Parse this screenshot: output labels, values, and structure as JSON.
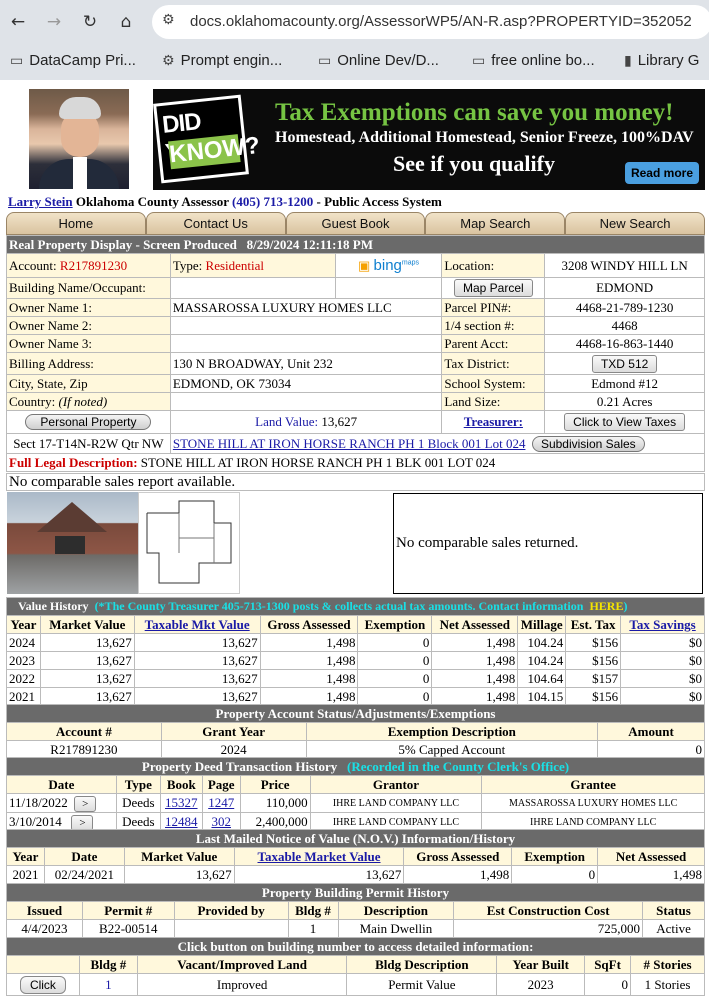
{
  "browser": {
    "url": "docs.oklahomacounty.org/AssessorWP5/AN-R.asp?PROPERTYID=352052",
    "bookmarks": [
      "DataCamp Pri...",
      "Prompt engin...",
      "Online Dev/D...",
      "free online bo...",
      "Library G"
    ]
  },
  "banner": {
    "badge_top": "DID YOU",
    "badge_bottom": "KNOW?",
    "headline": "Tax Exemptions can save you money!",
    "subline": "Homestead, Additional Homestead, Senior Freeze, 100%DAV",
    "cta": "See if you qualify",
    "read_more": "Read more"
  },
  "header": {
    "assessor_name": "Larry Stein",
    "office": "Oklahoma County Assessor",
    "phone": "(405) 713-1200",
    "tagline": "- Public Access System"
  },
  "menu": [
    "Home",
    "Contact Us",
    "Guest Book",
    "Map Search",
    "New Search"
  ],
  "display": {
    "title": "Real Property Display - Screen Produced",
    "produced": "8/29/2024 12:11:18 PM"
  },
  "property": {
    "account_label": "Account:",
    "account": "R217891230",
    "type_label": "Type:",
    "type": "Residential",
    "bing": "bing",
    "bing_sub": "maps",
    "location_label": "Location:",
    "location": "3208 WINDY HILL LN",
    "building_label": "Building Name/Occupant:",
    "map_parcel": "Map Parcel",
    "city": "EDMOND",
    "owner1_label": "Owner Name 1:",
    "owner1": "MASSAROSSA LUXURY HOMES LLC",
    "pin_label": "Parcel PIN#:",
    "pin": "4468-21-789-1230",
    "owner2_label": "Owner Name 2:",
    "quarter_label": "1/4 section #:",
    "quarter": "4468",
    "owner3_label": "Owner Name 3:",
    "parent_label": "Parent Acct:",
    "parent": "4468-16-863-1440",
    "billing_label": "Billing Address:",
    "billing": "130 N BROADWAY, Unit 232",
    "taxdist_label": "Tax District:",
    "taxdist": "TXD 512",
    "csz_label": "City, State, Zip",
    "csz": "EDMOND, OK  73034",
    "school_label": "School System:",
    "school": "Edmond #12",
    "country_label": "Country:",
    "country_note": "(If noted)",
    "landsize_label": "Land Size:",
    "landsize": "0.21  Acres",
    "personal_property": "Personal Property",
    "land_value_label": "Land Value:",
    "land_value": "13,627",
    "treasurer": "Treasurer:",
    "view_taxes": "Click to View Taxes",
    "sect": "Sect 17-T14N-R2W Qtr NW",
    "subdivision": "STONE HILL AT IRON HORSE RANCH PH 1   Block 001  Lot 024",
    "subdivision_sales": "Subdivision Sales",
    "legal_label": "Full Legal Description:",
    "legal": "STONE HILL AT IRON HORSE RANCH PH 1 BLK 001 LOT 024"
  },
  "comparables": {
    "report": "No comparable sales report available.",
    "returned": "No comparable sales returned."
  },
  "value_history": {
    "title": "Value History",
    "note": "(*The County Treasurer 405-713-1300 posts & collects actual tax amounts.  Contact information",
    "here": "HERE",
    "close": ")",
    "columns": [
      "Year",
      "Market Value",
      "Taxable Mkt Value",
      "Gross Assessed",
      "Exemption",
      "Net Assessed",
      "Millage",
      "Est. Tax",
      "Tax Savings"
    ],
    "rows": [
      [
        "2024",
        "13,627",
        "13,627",
        "1,498",
        "0",
        "1,498",
        "104.24",
        "$156",
        "$0"
      ],
      [
        "2023",
        "13,627",
        "13,627",
        "1,498",
        "0",
        "1,498",
        "104.24",
        "$156",
        "$0"
      ],
      [
        "2022",
        "13,627",
        "13,627",
        "1,498",
        "0",
        "1,498",
        "104.64",
        "$157",
        "$0"
      ],
      [
        "2021",
        "13,627",
        "13,627",
        "1,498",
        "0",
        "1,498",
        "104.15",
        "$156",
        "$0"
      ]
    ]
  },
  "account_status": {
    "title": "Property Account Status/Adjustments/Exemptions",
    "columns": [
      "Account #",
      "Grant Year",
      "Exemption Description",
      "Amount"
    ],
    "rows": [
      [
        "R217891230",
        "2024",
        "5% Capped Account",
        "0"
      ]
    ]
  },
  "deeds": {
    "title": "Property Deed Transaction History",
    "link": "(Recorded in the County Clerk's Office)",
    "columns": [
      "Date",
      "Type",
      "Book",
      "Page",
      "Price",
      "Grantor",
      "Grantee"
    ],
    "arrow": ">",
    "rows": [
      [
        "11/18/2022",
        "Deeds",
        "15327",
        "1247",
        "110,000",
        "IHRE LAND COMPANY LLC",
        "MASSAROSSA LUXURY HOMES LLC"
      ],
      [
        "3/10/2014",
        "Deeds",
        "12484",
        "302",
        "2,400,000",
        "IHRE LAND COMPANY LLC",
        "IHRE LAND COMPANY LLC"
      ]
    ]
  },
  "nov": {
    "title": "Last Mailed Notice of Value (N.O.V.) Information/History",
    "columns": [
      "Year",
      "Date",
      "Market Value",
      "Taxable Market Value",
      "Gross Assessed",
      "Exemption",
      "Net Assessed"
    ],
    "rows": [
      [
        "2021",
        "02/24/2021",
        "13,627",
        "13,627",
        "1,498",
        "0",
        "1,498"
      ]
    ]
  },
  "permits": {
    "title": "Property Building Permit History",
    "columns": [
      "Issued",
      "Permit #",
      "Provided by",
      "Bldg #",
      "Description",
      "Est Construction Cost",
      "Status"
    ],
    "rows": [
      [
        "4/4/2023",
        "B22-00514",
        "",
        "1",
        "Main Dwellin",
        "725,000",
        "Active"
      ]
    ]
  },
  "buildings": {
    "title": "Click button on building number to access detailed information:",
    "columns": [
      "",
      "Bldg #",
      "Vacant/Improved Land",
      "Bldg Description",
      "Year Built",
      "SqFt",
      "# Stories"
    ],
    "click": "Click",
    "rows": [
      [
        "1",
        "Improved",
        "Permit Value",
        "2023",
        "0",
        "1 Stories"
      ]
    ]
  }
}
